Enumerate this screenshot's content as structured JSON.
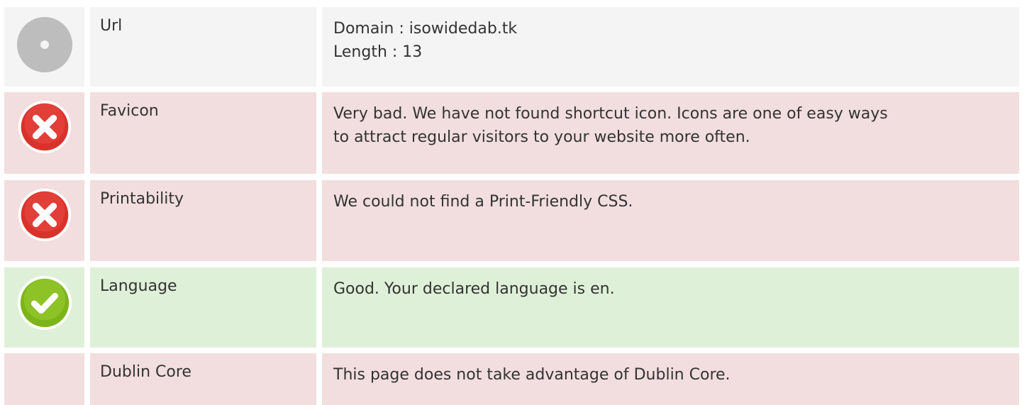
{
  "rows": [
    {
      "status": "neutral",
      "icon": "info-disc-icon",
      "label": "Url",
      "lines": [
        "Domain : isowidedab.tk",
        "Length : 13"
      ]
    },
    {
      "status": "bad",
      "icon": "error-x-icon",
      "label": "Favicon",
      "lines": [
        "Very bad. We have not found shortcut icon. Icons are one of easy ways",
        "to attract regular visitors to your website more often."
      ]
    },
    {
      "status": "bad",
      "icon": "error-x-icon",
      "label": "Printability",
      "lines": [
        "We could not find a Print-Friendly CSS."
      ]
    },
    {
      "status": "good",
      "icon": "check-mark-icon",
      "label": "Language",
      "lines": [
        "Good. Your declared language is en."
      ]
    },
    {
      "status": "bad",
      "icon": "",
      "label": "Dublin Core",
      "lines": [
        "This page does not take advantage of Dublin Core."
      ]
    }
  ],
  "colors": {
    "neutral_bg": "#f4f4f4",
    "bad_bg": "#f2dede",
    "good_bg": "#dff0d8",
    "error_icon": "#d9322b",
    "good_icon": "#7cb518",
    "neutral_icon": "#bdbdbd"
  }
}
